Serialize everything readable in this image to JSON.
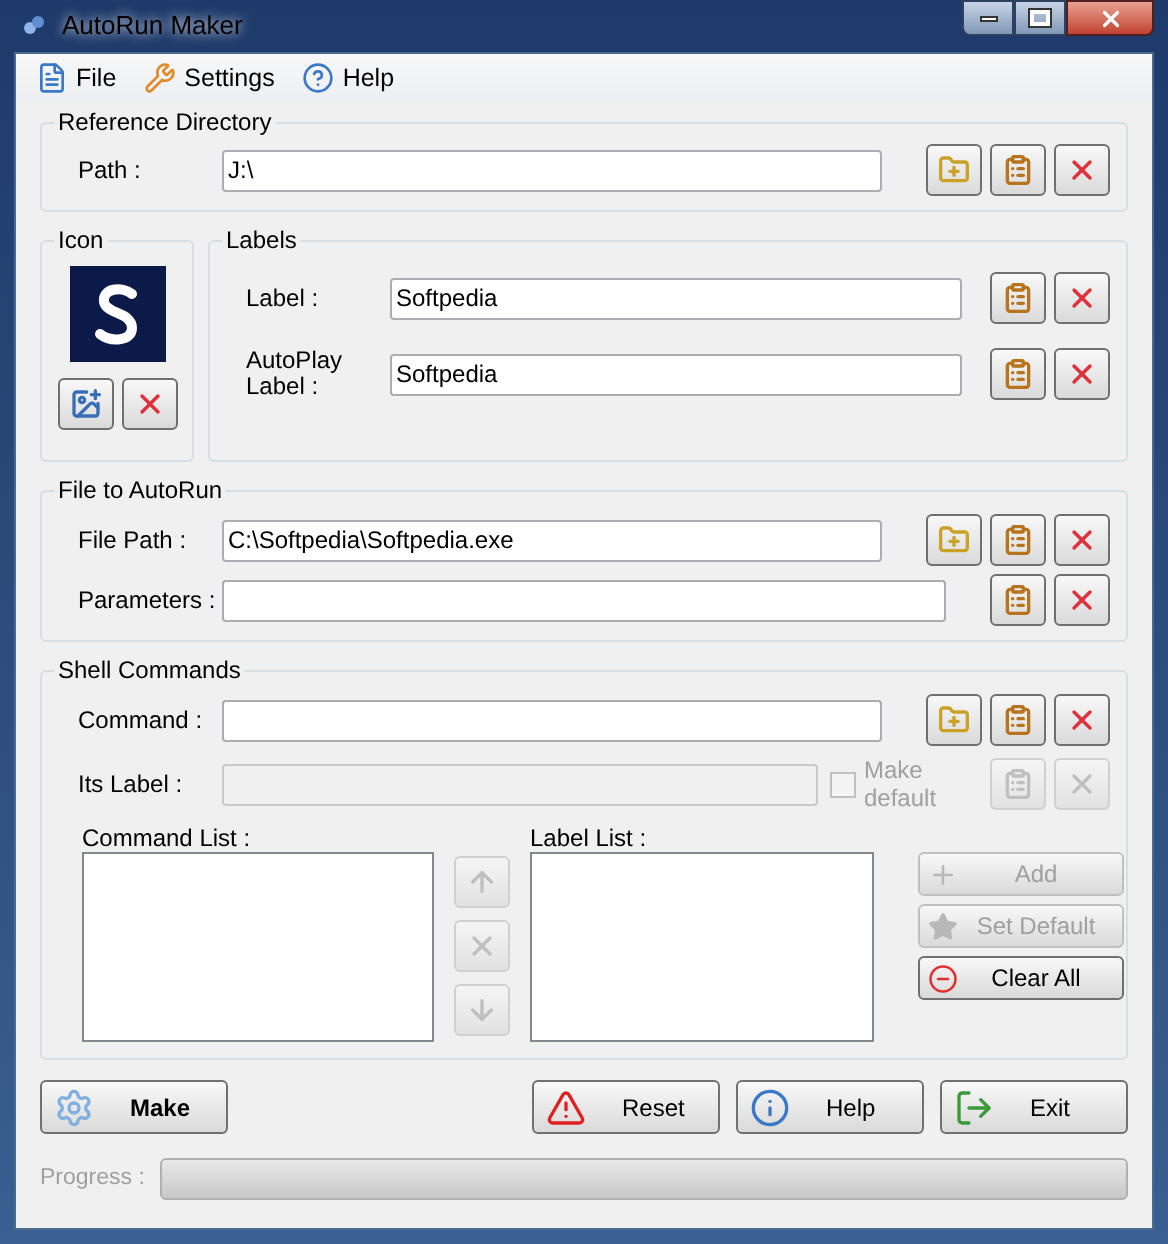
{
  "window": {
    "title": "AutoRun Maker"
  },
  "menu": [
    {
      "label": "File",
      "kind": "file"
    },
    {
      "label": "Settings",
      "kind": "settings"
    },
    {
      "label": "Help",
      "kind": "help"
    }
  ],
  "reference_directory": {
    "title": "Reference Directory",
    "fields": [
      {
        "label": "Path :",
        "value": "J:\\",
        "disabled": false,
        "buttons": [
          {
            "kind": "browse",
            "disabled": false
          },
          {
            "kind": "paste",
            "disabled": false
          },
          {
            "kind": "clear",
            "disabled": false
          }
        ]
      }
    ]
  },
  "icon": {
    "title": "Icon",
    "buttons": [
      {
        "kind": "pick",
        "disabled": false
      },
      {
        "kind": "clear",
        "disabled": false
      }
    ]
  },
  "labels": {
    "title": "Labels",
    "fields": [
      {
        "label": "Label :",
        "value": "Softpedia",
        "disabled": false,
        "buttons": [
          {
            "kind": "paste",
            "disabled": false
          },
          {
            "kind": "clear",
            "disabled": false
          }
        ]
      },
      {
        "label": "AutoPlay Label :",
        "value": "Softpedia",
        "disabled": false,
        "buttons": [
          {
            "kind": "paste",
            "disabled": false
          },
          {
            "kind": "clear",
            "disabled": false
          }
        ]
      }
    ]
  },
  "file_to_autorun": {
    "title": "File to AutoRun",
    "fields": [
      {
        "label": "File Path :",
        "value": "C:\\Softpedia\\Softpedia.exe",
        "disabled": false,
        "buttons": [
          {
            "kind": "browse",
            "disabled": false
          },
          {
            "kind": "paste",
            "disabled": false
          },
          {
            "kind": "clear",
            "disabled": false
          }
        ]
      },
      {
        "label": "Parameters :",
        "disabled": false,
        "buttons": [
          {
            "kind": "paste",
            "disabled": false
          },
          {
            "kind": "clear",
            "disabled": false
          }
        ]
      }
    ]
  },
  "shell_commands": {
    "title": "Shell Commands",
    "command": {
      "label": "Command :",
      "disabled": false,
      "buttons": [
        {
          "kind": "browse",
          "disabled": false
        },
        {
          "kind": "paste",
          "disabled": false
        },
        {
          "kind": "clear",
          "disabled": false
        }
      ]
    },
    "its_label": {
      "label": "Its Label :",
      "disabled": true,
      "buttons": [
        {
          "kind": "paste",
          "disabled": true
        },
        {
          "kind": "clear",
          "disabled": true
        }
      ]
    },
    "make_default": {
      "label": "Make default",
      "checked": false,
      "disabled": true
    },
    "command_list": {
      "label": "Command List :"
    },
    "move_buttons": [
      {
        "kind": "up",
        "disabled": true
      },
      {
        "kind": "remove",
        "disabled": true
      },
      {
        "kind": "down",
        "disabled": true
      }
    ],
    "label_list": {
      "label": "Label List :"
    },
    "side_buttons": [
      {
        "label": "Add",
        "kind": "add",
        "disabled": true
      },
      {
        "label": "Set Default",
        "kind": "star",
        "disabled": true
      },
      {
        "label": "Clear All",
        "kind": "clear_all",
        "disabled": false
      }
    ]
  },
  "actions": [
    {
      "label": "Make",
      "kind": "make"
    },
    {
      "label": "Reset",
      "kind": "reset"
    },
    {
      "label": "Help",
      "kind": "help"
    },
    {
      "label": "Exit",
      "kind": "exit"
    }
  ],
  "progress": {
    "label": "Progress :",
    "disabled": true,
    "level": 0
  }
}
